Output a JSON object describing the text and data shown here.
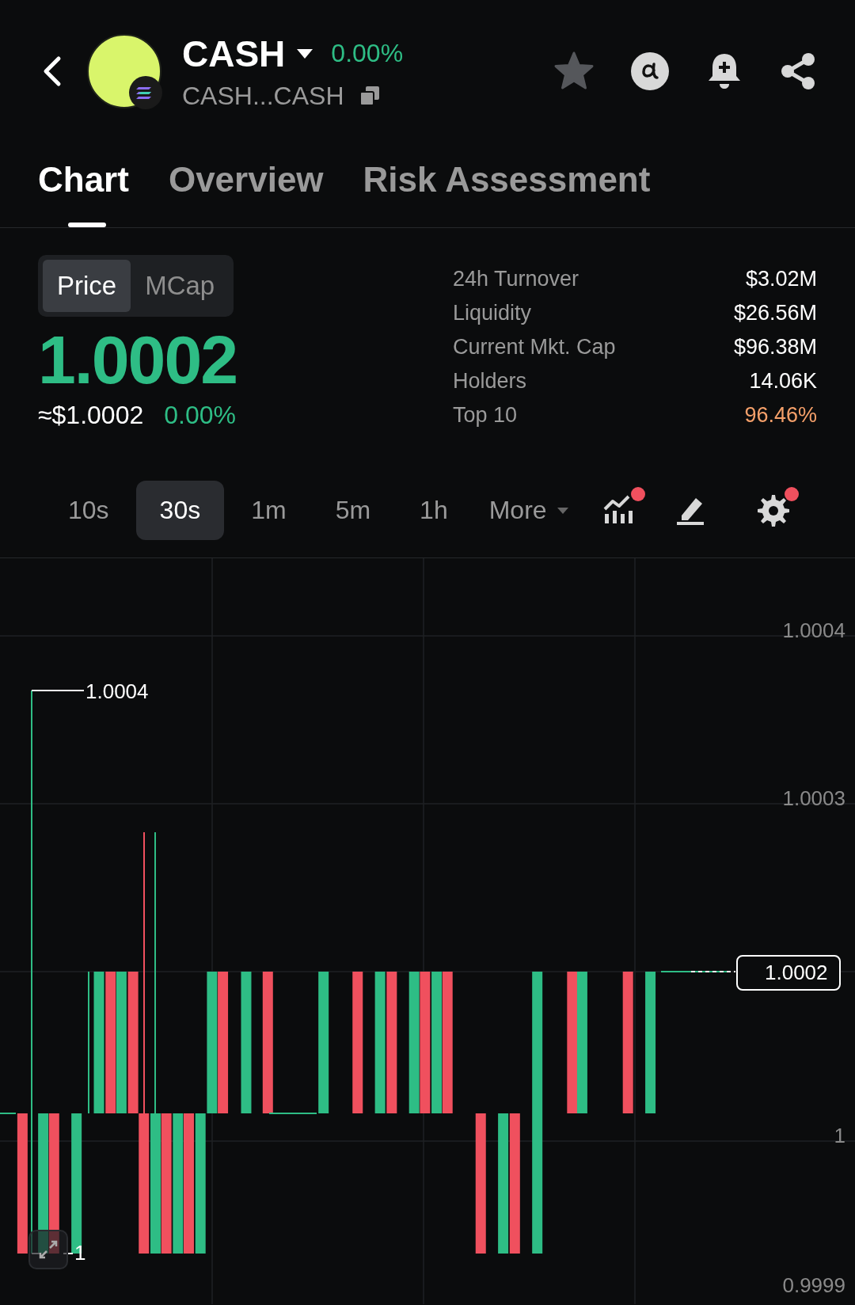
{
  "header": {
    "title": "CASH",
    "change": "0.00%",
    "subtitle": "CASH...CASH"
  },
  "tabs": [
    {
      "label": "Chart",
      "selected": true
    },
    {
      "label": "Overview",
      "selected": false
    },
    {
      "label": "Risk Assessment",
      "selected": false
    }
  ],
  "mode_toggle": [
    {
      "label": "Price",
      "selected": true
    },
    {
      "label": "MCap",
      "selected": false
    }
  ],
  "price": "1.0002",
  "usd_price": "≈$1.0002",
  "usd_change": "0.00%",
  "stats": [
    {
      "label": "24h Turnover",
      "value": "$3.02M",
      "highlighted": false
    },
    {
      "label": "Liquidity",
      "value": "$26.56M",
      "highlighted": false
    },
    {
      "label": "Current Mkt. Cap",
      "value": "$96.38M",
      "highlighted": false
    },
    {
      "label": "Holders",
      "value": "14.06K",
      "highlighted": false
    },
    {
      "label": "Top 10",
      "value": "96.46%",
      "highlighted": true
    }
  ],
  "intervals": [
    {
      "label": "10s",
      "selected": false
    },
    {
      "label": "30s",
      "selected": true
    },
    {
      "label": "1m",
      "selected": false
    },
    {
      "label": "5m",
      "selected": false
    },
    {
      "label": "1h",
      "selected": false
    }
  ],
  "more": "More",
  "tools": [
    {
      "kind": "indicators",
      "badge": true
    },
    {
      "kind": "draw",
      "badge": false
    },
    {
      "kind": "settings",
      "badge": true
    }
  ],
  "chart": {
    "y_labels": [
      "1.0004",
      "1.0003",
      "1",
      "0.9999"
    ],
    "high_label": "1.0004",
    "low_label": "1",
    "last_price": "1.0002"
  }
}
